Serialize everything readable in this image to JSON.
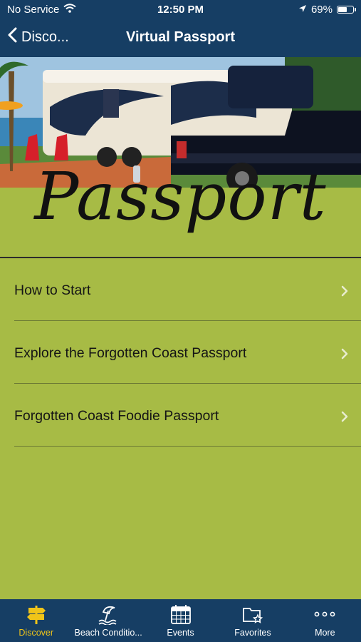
{
  "status_bar": {
    "carrier": "No Service",
    "time": "12:50 PM",
    "battery": "69%",
    "battery_level": 0.69
  },
  "nav": {
    "back_label": "Disco...",
    "title": "Virtual Passport"
  },
  "hero": {
    "banner_text": "Passport"
  },
  "list": {
    "items": [
      {
        "label": "How to Start"
      },
      {
        "label": "Explore the Forgotten Coast Passport"
      },
      {
        "label": "Forgotten Coast Foodie Passport"
      }
    ]
  },
  "tabbar": {
    "items": [
      {
        "label": "Discover",
        "icon": "signpost-icon",
        "active": true
      },
      {
        "label": "Beach Conditio...",
        "icon": "umbrella-beach-icon",
        "active": false
      },
      {
        "label": "Events",
        "icon": "calendar-icon",
        "active": false
      },
      {
        "label": "Favorites",
        "icon": "favorites-folder-icon",
        "active": false
      },
      {
        "label": "More",
        "icon": "more-icon",
        "active": false
      }
    ]
  },
  "colors": {
    "nav_bg": "#163e64",
    "content_bg": "#a7bb45",
    "active_tab": "#f0c419"
  }
}
